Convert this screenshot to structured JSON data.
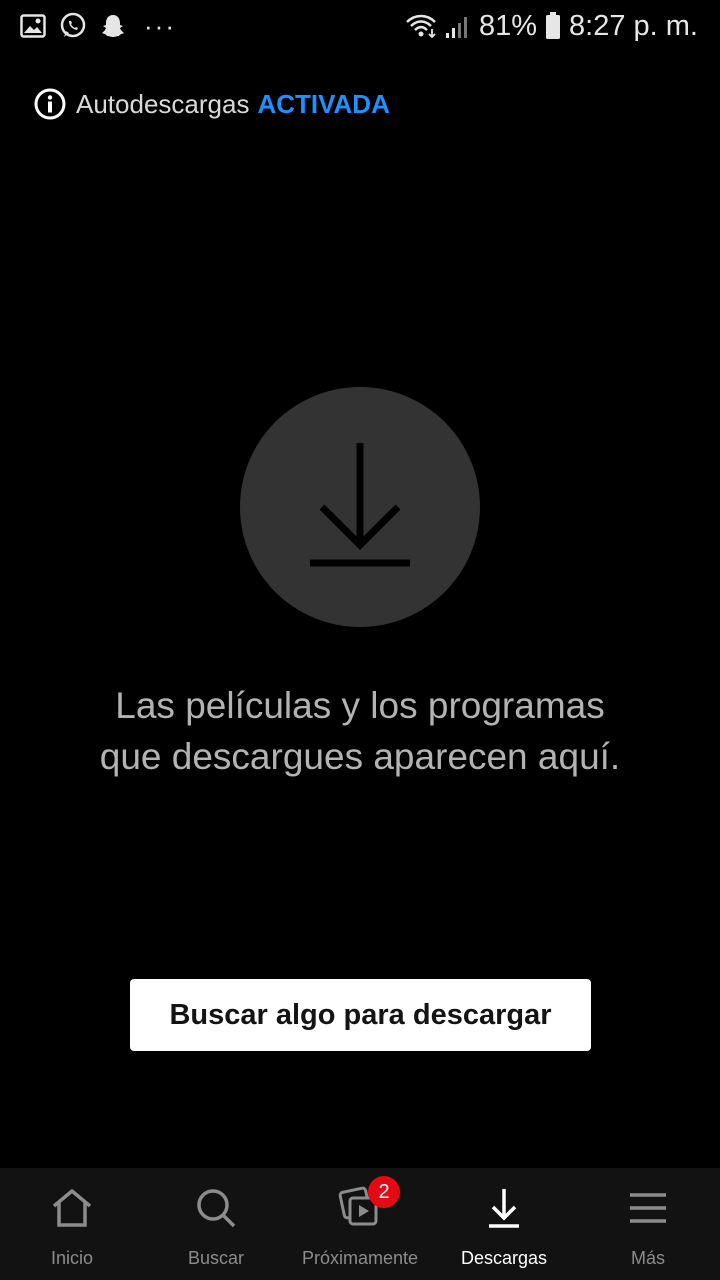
{
  "status_bar": {
    "left_icons": [
      "gallery-icon",
      "whatsapp-icon",
      "snapchat-icon"
    ],
    "more_dots": "···",
    "battery_percent": "81%",
    "time": "8:27 p. m."
  },
  "autodownload": {
    "label": "Autodescargas",
    "status": "ACTIVADA",
    "status_color": "#1e90ff"
  },
  "empty_state": {
    "icon": "download-icon",
    "line1": "Las películas y los programas",
    "line2": "que descargues aparecen aquí.",
    "button_label": "Buscar algo para descargar"
  },
  "bottom_nav": {
    "items": [
      {
        "label": "Inicio",
        "icon": "home-icon"
      },
      {
        "label": "Buscar",
        "icon": "search-icon"
      },
      {
        "label": "Próximamente",
        "icon": "coming-soon-icon",
        "badge": "2"
      },
      {
        "label": "Descargas",
        "icon": "download-icon",
        "active": true
      },
      {
        "label": "Más",
        "icon": "menu-icon"
      }
    ],
    "badge_color": "#e50914"
  }
}
